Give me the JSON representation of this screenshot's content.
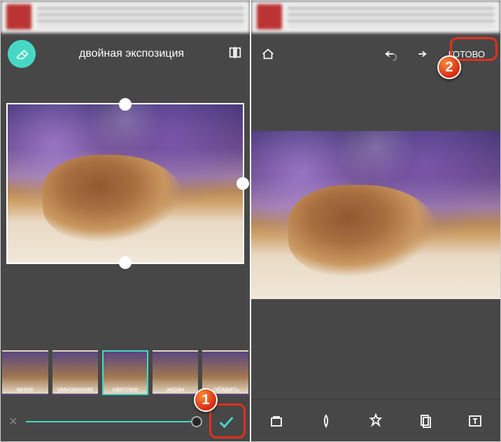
{
  "left": {
    "title": "двойная экспозиция",
    "blend_modes": [
      {
        "label": "мнее"
      },
      {
        "label": "умножение"
      },
      {
        "label": "светлее",
        "selected": true
      },
      {
        "label": "экран"
      },
      {
        "label": ".обавить"
      }
    ],
    "callout": "1"
  },
  "right": {
    "done_label": "ГОТОВО",
    "callout": "2"
  },
  "icons": {
    "eraser": "eraser",
    "compare": "compare",
    "home": "home",
    "undo": "undo",
    "redo": "redo",
    "close": "×",
    "check": "✓",
    "styles": "styles-icon",
    "looks": "looks-icon",
    "tools": "tools-icon",
    "export": "export-icon",
    "text": "text-icon"
  }
}
